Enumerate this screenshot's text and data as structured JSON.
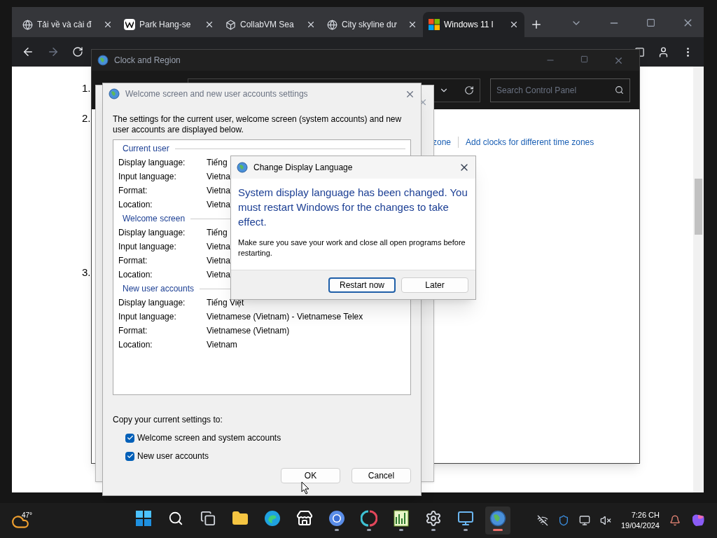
{
  "browser": {
    "tabs": [
      {
        "title": "Tải về và cài đ",
        "kind": "globe",
        "selected": false
      },
      {
        "title": "Park Hang-se",
        "kind": "wiki",
        "selected": false
      },
      {
        "title": "CollabVM Sea",
        "kind": "cube",
        "selected": false
      },
      {
        "title": "City skyline dư",
        "kind": "globe",
        "selected": false
      },
      {
        "title": "Windows 11 l",
        "kind": "windows",
        "selected": true
      }
    ],
    "page_steps": [
      "1.",
      "2.",
      "3."
    ]
  },
  "clock_region": {
    "title": "Clock and Region",
    "search_placeholder": "Search Control Panel",
    "links": [
      "zone",
      "Add clocks for different time zones"
    ]
  },
  "welcome_dialog": {
    "title": "Welcome screen and new user accounts settings",
    "intro": "The settings for the current user, welcome screen (system accounts) and new user accounts are displayed below.",
    "sections": [
      {
        "title": "Current user",
        "rows": [
          {
            "label": "Display language:",
            "value": "Tiếng"
          },
          {
            "label": "Input language:",
            "value": "Vietna"
          },
          {
            "label": "Format:",
            "value": "Vietna"
          },
          {
            "label": "Location:",
            "value": "Vietna"
          }
        ]
      },
      {
        "title": "Welcome screen",
        "rows": [
          {
            "label": "Display language:",
            "value": "Tiếng"
          },
          {
            "label": "Input language:",
            "value": "Vietna"
          },
          {
            "label": "Format:",
            "value": "Vietna"
          },
          {
            "label": "Location:",
            "value": "Vietna"
          }
        ]
      },
      {
        "title": "New user accounts",
        "rows": [
          {
            "label": "Display language:",
            "value": "Tiếng Việt"
          },
          {
            "label": "Input language:",
            "value": "Vietnamese (Vietnam) - Vietnamese Telex"
          },
          {
            "label": "Format:",
            "value": "Vietnamese (Vietnam)"
          },
          {
            "label": "Location:",
            "value": "Vietnam"
          }
        ]
      }
    ],
    "copy_label": "Copy your current settings to:",
    "checkboxes": [
      {
        "label": "Welcome screen and system accounts",
        "checked": true
      },
      {
        "label": "New user accounts",
        "checked": true
      }
    ],
    "buttons": [
      {
        "label": "OK",
        "default": false
      },
      {
        "label": "Cancel",
        "default": false
      }
    ]
  },
  "change_dialog": {
    "title": "Change Display Language",
    "headline": "System display language has been changed. You must restart Windows for the changes to take effect.",
    "message": "Make sure you save your work and close all open programs before restarting.",
    "buttons": [
      {
        "label": "Restart now",
        "default": true
      },
      {
        "label": "Later",
        "default": false
      }
    ]
  },
  "taskbar": {
    "weather": "47°",
    "time": "7:26 CH",
    "date": "19/04/2024",
    "apps": [
      {
        "kind": "start",
        "running": false,
        "active": false
      },
      {
        "kind": "search",
        "running": false,
        "active": false
      },
      {
        "kind": "taskview",
        "running": false,
        "active": false
      },
      {
        "kind": "folder",
        "running": false,
        "active": false
      },
      {
        "kind": "edge",
        "running": false,
        "active": false
      },
      {
        "kind": "store",
        "running": false,
        "active": false
      },
      {
        "kind": "chrome",
        "running": true,
        "active": false
      },
      {
        "kind": "snip",
        "running": true,
        "active": false
      },
      {
        "kind": "chart",
        "running": true,
        "active": false
      },
      {
        "kind": "settings",
        "running": true,
        "active": false
      },
      {
        "kind": "remote",
        "running": true,
        "active": false
      },
      {
        "kind": "clock",
        "running": true,
        "active": true
      }
    ]
  }
}
